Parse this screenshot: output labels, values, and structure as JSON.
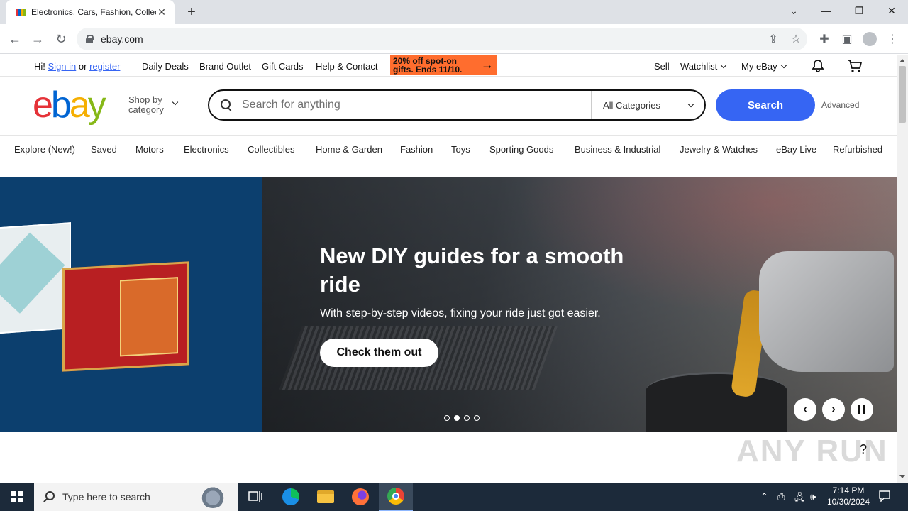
{
  "browser": {
    "tab_title": "Electronics, Cars, Fashion, Collectibles & More | eBay",
    "new_tab_symbol": "+",
    "url": "ebay.com"
  },
  "topbar": {
    "greeting": "Hi!",
    "sign_in": "Sign in",
    "or": "or",
    "register": "register",
    "links": [
      "Daily Deals",
      "Brand Outlet",
      "Gift Cards",
      "Help & Contact"
    ],
    "promo": "20% off spot-on gifts. Ends 11/10.",
    "sell": "Sell",
    "watchlist": "Watchlist",
    "my_ebay": "My eBay"
  },
  "header": {
    "logo_letters": [
      "e",
      "b",
      "a",
      "y"
    ],
    "logo_colors": [
      "#e53238",
      "#0064d2",
      "#f5af02",
      "#86b817"
    ],
    "shop_by_line1": "Shop by",
    "shop_by_line2": "category",
    "search_placeholder": "Search for anything",
    "category_select": "All Categories",
    "search_button": "Search",
    "advanced": "Advanced"
  },
  "categories": [
    "Explore (New!)",
    "Saved",
    "Motors",
    "Electronics",
    "Collectibles",
    "Home & Garden",
    "Fashion",
    "Toys",
    "Sporting Goods",
    "Business & Industrial",
    "Jewelry & Watches",
    "eBay Live",
    "Refurbished"
  ],
  "hero": {
    "title": "New DIY guides for a smooth ride",
    "subtitle": "With step-by-step videos, fixing your ride just got easier.",
    "cta": "Check them out",
    "slide_count": 4,
    "active_slide": 2
  },
  "help_symbol": "?",
  "watermark": "ANY RUN",
  "taskbar": {
    "search_placeholder": "Type here to search",
    "time": "7:14 PM",
    "date": "10/30/2024"
  },
  "colors": {
    "ebay_blue": "#3665f3",
    "promo_orange": "#ff6d2e",
    "hero_left_bg": "#0c3f6e"
  }
}
